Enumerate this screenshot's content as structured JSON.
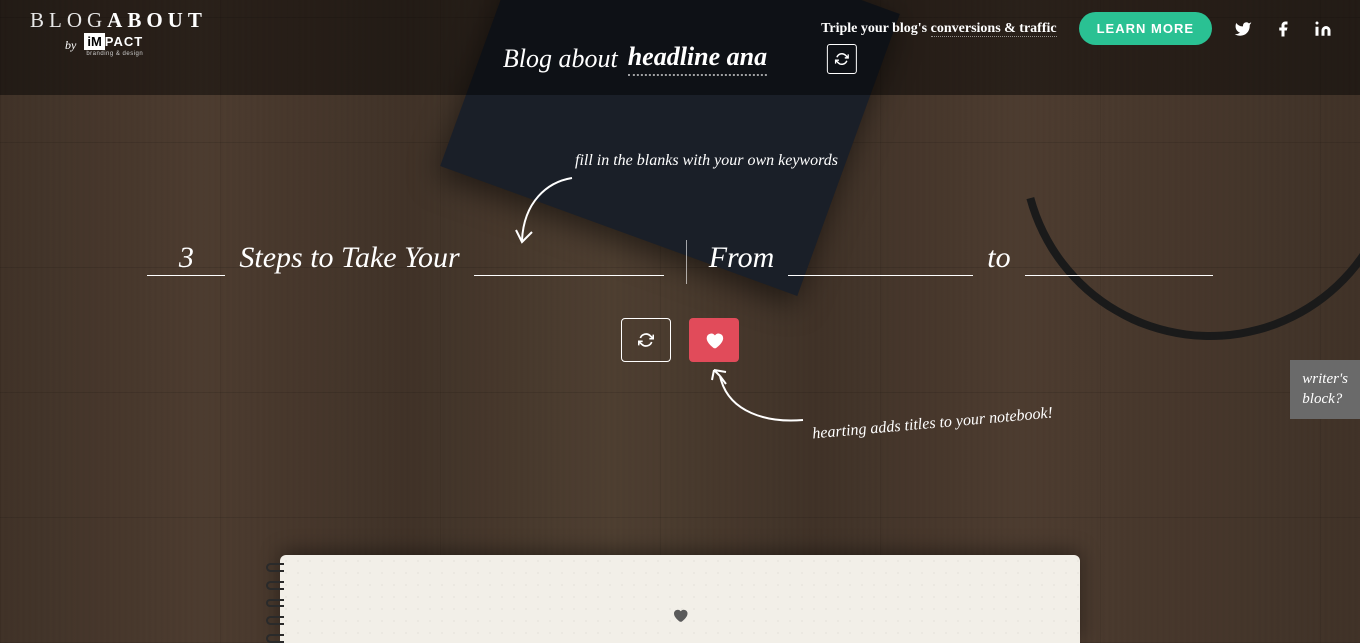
{
  "logo": {
    "part1": "BLOG",
    "part2": "ABOUT",
    "by": "by",
    "impact_im": "iM",
    "impact_pact": "PACT",
    "impact_tag": "branding & design"
  },
  "header": {
    "promo_prefix": "Triple your blog's ",
    "promo_underlined": "conversions & traffic",
    "learn_more": "LEARN MORE"
  },
  "topic": {
    "prefix": "Blog about ",
    "value": "headline ana"
  },
  "hints": {
    "fill": "fill in the blanks with your own keywords",
    "heart": "hearting adds titles to your notebook!"
  },
  "headline": {
    "blank1_value": "3",
    "text1": "Steps to Take Your",
    "blank2_value": "",
    "text2": "From",
    "blank3_value": "",
    "text3": "to",
    "blank4_value": ""
  },
  "sidebar": {
    "writers_block_l1": "writer's",
    "writers_block_l2": "block?"
  },
  "colors": {
    "accent_green": "#2ac193",
    "accent_red": "#e14b5a"
  }
}
